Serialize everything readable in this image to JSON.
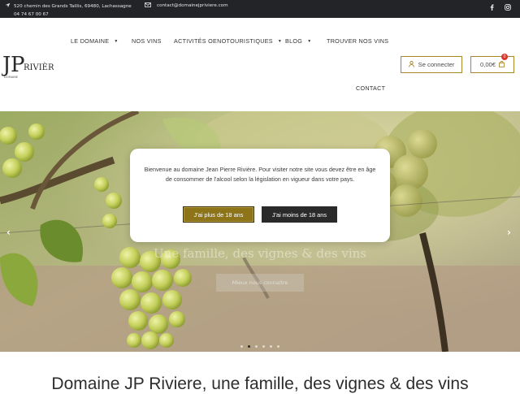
{
  "topbar": {
    "address_line1": "520 chemin des Grands Taillis, 69480, Lachassagne",
    "address_line2": "04 74 67 00 67",
    "email": "contact@domainejpriviere.com",
    "icons": [
      "location-arrow-icon",
      "envelope-icon",
      "facebook-icon",
      "instagram-icon"
    ]
  },
  "logo": {
    "text": "JP Riviere",
    "subtext": "DOMAINE"
  },
  "nav": {
    "items": [
      {
        "label": "LE DOMAINE",
        "dropdown": true
      },
      {
        "label": "NOS VINS",
        "dropdown": false
      },
      {
        "label": "ACTIVITÉS OENOTOURISTIQUES",
        "dropdown": true
      },
      {
        "label": "BLOG",
        "dropdown": true
      },
      {
        "label": "TROUVER NOS VINS",
        "dropdown": false
      },
      {
        "label": "CONTACT",
        "dropdown": false
      }
    ]
  },
  "account": {
    "login_label": "Se connecter"
  },
  "cart": {
    "amount": "0,00€",
    "count": "0"
  },
  "hero": {
    "slide_title": "Une famille, des vignes & des vins",
    "slide_button": "Mieux nous connaitre",
    "slide_count": 6,
    "active_slide": 2
  },
  "age_gate": {
    "message": "Bienvenue au domaine Jean Pierre Rivière. Pour visiter notre site vous devez être en âge de consommer de l'alcool selon la législation en vigueur dans votre pays.",
    "yes_label": "J'ai plus de 18 ans",
    "no_label": "J'ai moins de 18 ans"
  },
  "section": {
    "title": "Domaine JP Riviere, une famille, des vignes & des vins"
  },
  "colors": {
    "accent": "#a8872a",
    "dark": "#222428",
    "badge": "#d9342b"
  }
}
